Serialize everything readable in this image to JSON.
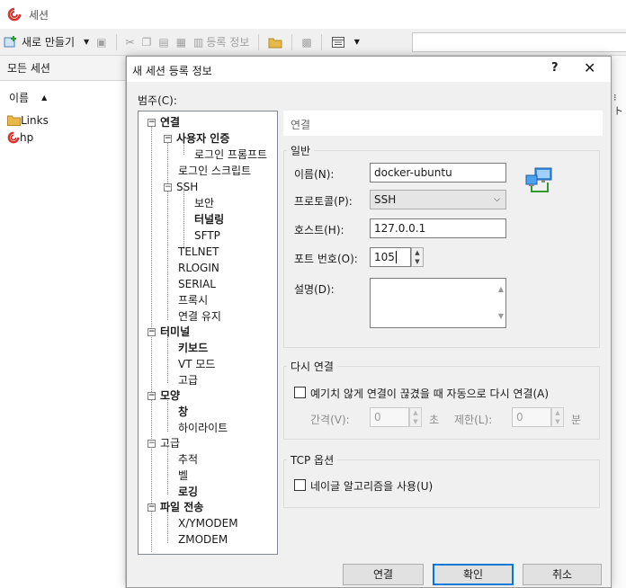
{
  "window": {
    "title": "세션"
  },
  "toolbar": {
    "new_label": "새로 만들기",
    "register_info_label": "등록 정보"
  },
  "left_panel": {
    "header": "모든 세션",
    "column": "이름",
    "items": [
      {
        "label": "Links",
        "icon": "folder-icon"
      },
      {
        "label": "hp",
        "icon": "session-icon"
      }
    ]
  },
  "dialog": {
    "title": "새 세션 등록 정보",
    "help": "?",
    "close": "✕",
    "category_label": "범주(C):",
    "tree": [
      {
        "label": "연결",
        "bold": true,
        "toggle": "−"
      },
      {
        "label": "사용자 인증",
        "bold": true,
        "toggle": "−"
      },
      {
        "label": "로그인 프롬프트",
        "bold": false
      },
      {
        "label": "로그인 스크립트",
        "bold": false
      },
      {
        "label": "SSH",
        "bold": false,
        "toggle": "−"
      },
      {
        "label": "보안",
        "bold": false
      },
      {
        "label": "터널링",
        "bold": true
      },
      {
        "label": "SFTP",
        "bold": false
      },
      {
        "label": "TELNET",
        "bold": false
      },
      {
        "label": "RLOGIN",
        "bold": false
      },
      {
        "label": "SERIAL",
        "bold": false
      },
      {
        "label": "프록시",
        "bold": false
      },
      {
        "label": "연결 유지",
        "bold": false
      },
      {
        "label": "터미널",
        "bold": true,
        "toggle": "−"
      },
      {
        "label": "키보드",
        "bold": true
      },
      {
        "label": "VT 모드",
        "bold": false
      },
      {
        "label": "고급",
        "bold": false
      },
      {
        "label": "모양",
        "bold": true,
        "toggle": "−"
      },
      {
        "label": "창",
        "bold": true
      },
      {
        "label": "하이라이트",
        "bold": false
      },
      {
        "label": "고급",
        "bold": false,
        "toggle": "−"
      },
      {
        "label": "추적",
        "bold": false
      },
      {
        "label": "벨",
        "bold": false
      },
      {
        "label": "로깅",
        "bold": true
      },
      {
        "label": "파일 전송",
        "bold": true,
        "toggle": "−"
      },
      {
        "label": "X/YMODEM",
        "bold": false
      },
      {
        "label": "ZMODEM",
        "bold": false
      }
    ],
    "section_title": "연결",
    "general": {
      "title": "일반",
      "name_label": "이름(N):",
      "name_value": "docker-ubuntu",
      "protocol_label": "프로토콜(P):",
      "protocol_value": "SSH",
      "host_label": "호스트(H):",
      "host_value": "127.0.0.1",
      "port_label": "포트 번호(O):",
      "port_value": "105",
      "desc_label": "설명(D):"
    },
    "reconnect": {
      "title": "다시 연결",
      "checkbox_label": "예기치 않게 연결이 끊겼을 때 자동으로 다시 연결(A)",
      "interval_label": "간격(V):",
      "interval_value": "0",
      "interval_unit": "초",
      "limit_label": "제한(L):",
      "limit_value": "0",
      "limit_unit": "분"
    },
    "tcp": {
      "title": "TCP 옵션",
      "checkbox_label": "네이글 알고리즘을 사용(U)"
    },
    "buttons": {
      "connect": "연결",
      "ok": "확인",
      "cancel": "취소"
    }
  },
  "colors": {
    "accent": "#0078d7",
    "logo": "#d9302c",
    "folder": "#e8b84a"
  }
}
